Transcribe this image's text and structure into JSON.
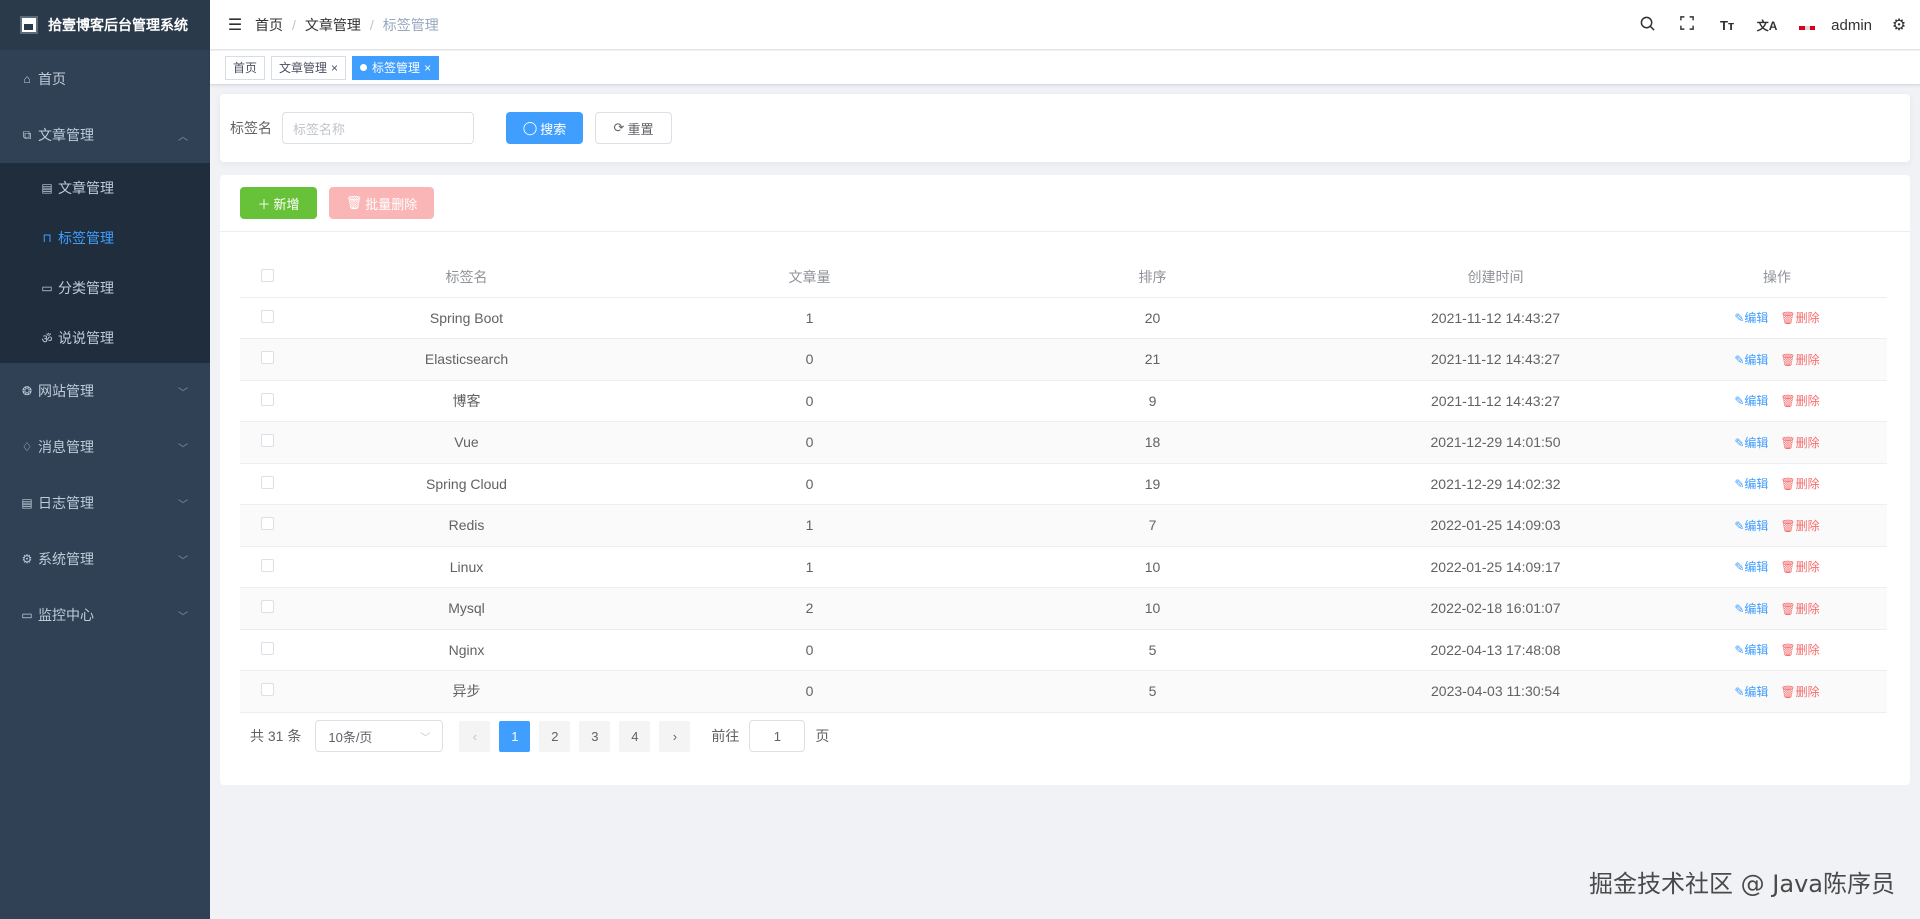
{
  "app": {
    "title": "拾壹博客后台管理系统"
  },
  "sidebar": {
    "items": [
      {
        "label": "首页",
        "icon": "home-icon"
      },
      {
        "label": "文章管理",
        "icon": "article-icon",
        "expanded": true,
        "children": [
          {
            "label": "文章管理",
            "icon": "document-icon"
          },
          {
            "label": "标签管理",
            "icon": "bookmark-icon",
            "active": true
          },
          {
            "label": "分类管理",
            "icon": "category-icon"
          },
          {
            "label": "说说管理",
            "icon": "chat-icon"
          }
        ]
      },
      {
        "label": "网站管理",
        "icon": "website-icon"
      },
      {
        "label": "消息管理",
        "icon": "bell-icon"
      },
      {
        "label": "日志管理",
        "icon": "log-icon"
      },
      {
        "label": "系统管理",
        "icon": "settings-icon"
      },
      {
        "label": "监控中心",
        "icon": "monitor-icon"
      }
    ]
  },
  "navbar": {
    "breadcrumb": [
      "首页",
      "文章管理",
      "标签管理"
    ],
    "user": "admin"
  },
  "tags": [
    {
      "label": "首页"
    },
    {
      "label": "文章管理",
      "closable": true
    },
    {
      "label": "标签管理",
      "closable": true,
      "active": true
    }
  ],
  "search": {
    "label": "标签名",
    "placeholder": "标签名称",
    "search_btn": "搜索",
    "reset_btn": "重置"
  },
  "toolbar": {
    "add_btn": "新增",
    "batch_delete_btn": "批量删除"
  },
  "table": {
    "headers": [
      "标签名",
      "文章量",
      "排序",
      "创建时间",
      "操作"
    ],
    "edit_label": "编辑",
    "delete_label": "删除",
    "rows": [
      {
        "name": "Spring Boot",
        "count": "1",
        "sort": "20",
        "created": "2021-11-12 14:43:27"
      },
      {
        "name": "Elasticsearch",
        "count": "0",
        "sort": "21",
        "created": "2021-11-12 14:43:27"
      },
      {
        "name": "博客",
        "count": "0",
        "sort": "9",
        "created": "2021-11-12 14:43:27"
      },
      {
        "name": "Vue",
        "count": "0",
        "sort": "18",
        "created": "2021-12-29 14:01:50"
      },
      {
        "name": "Spring Cloud",
        "count": "0",
        "sort": "19",
        "created": "2021-12-29 14:02:32"
      },
      {
        "name": "Redis",
        "count": "1",
        "sort": "7",
        "created": "2022-01-25 14:09:03"
      },
      {
        "name": "Linux",
        "count": "1",
        "sort": "10",
        "created": "2022-01-25 14:09:17"
      },
      {
        "name": "Mysql",
        "count": "2",
        "sort": "10",
        "created": "2022-02-18 16:01:07"
      },
      {
        "name": "Nginx",
        "count": "0",
        "sort": "5",
        "created": "2022-04-13 17:48:08"
      },
      {
        "name": "异步",
        "count": "0",
        "sort": "5",
        "created": "2023-04-03 11:30:54"
      }
    ]
  },
  "pagination": {
    "total_text": "共 31 条",
    "page_size": "10条/页",
    "pages": [
      "1",
      "2",
      "3",
      "4"
    ],
    "current": "1",
    "goto_label": "前往",
    "goto_value": "1",
    "page_suffix": "页"
  },
  "watermark": "掘金技术社区 @ Java陈序员",
  "colors": {
    "primary": "#409eff",
    "success": "#67c23a",
    "danger": "#f56c6c",
    "sidebar_bg": "#304156"
  }
}
